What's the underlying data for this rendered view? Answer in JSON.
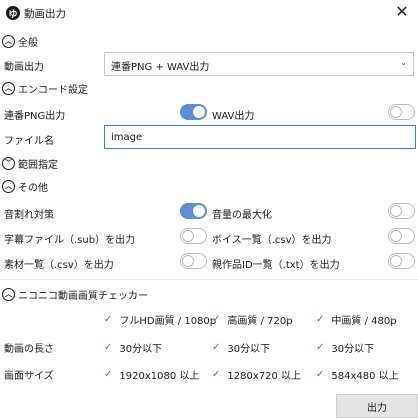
{
  "window": {
    "title": "動画出力",
    "app_icon_glyph": "ゆ",
    "close_glyph": "✕"
  },
  "sections": {
    "general": "全般",
    "encode": "エンコード設定",
    "range": "範囲指定",
    "other": "その他",
    "checker": "ニコニコ動画画質チェッカー"
  },
  "general": {
    "output_label": "動画出力",
    "output_value": "連番PNG + WAV出力"
  },
  "encode": {
    "png_label": "連番PNG出力",
    "png_on": true,
    "wav_label": "WAV出力",
    "wav_on": false,
    "filename_label": "ファイル名",
    "filename_value": "image"
  },
  "other": {
    "clip_label": "音割れ対策",
    "clip_on": true,
    "maximize_label": "音量の最大化",
    "maximize_on": false,
    "subs_label": "字幕ファイル（.sub）を出力",
    "subs_on": false,
    "voice_label": "ボイス一覧（.csv）を出力",
    "voice_on": false,
    "material_label": "素材一覧（.csv）を出力",
    "material_on": false,
    "parent_label": "親作品ID一覧（.txt）を出力",
    "parent_on": false
  },
  "checker": {
    "tick_glyph": "✓",
    "header": [
      "フルHD画質 / 1080p",
      "高画質 / 720p",
      "中画質 / 480p"
    ],
    "rows": [
      {
        "label": "動画の長さ",
        "values": [
          "30分以下",
          "30分以下",
          "30分以下"
        ]
      },
      {
        "label": "画面サイズ",
        "values": [
          "1920x1080 以上",
          "1280x720 以上",
          "584x480 以上"
        ]
      }
    ]
  },
  "footer": {
    "export_label": "出力"
  },
  "icons": {
    "expanded": "chevron-up-icon",
    "collapsed": "chevron-down-icon"
  },
  "colors": {
    "accent": "#5b8fd6",
    "check": "#3f8f3f",
    "focus_border": "#3a7bd5"
  }
}
